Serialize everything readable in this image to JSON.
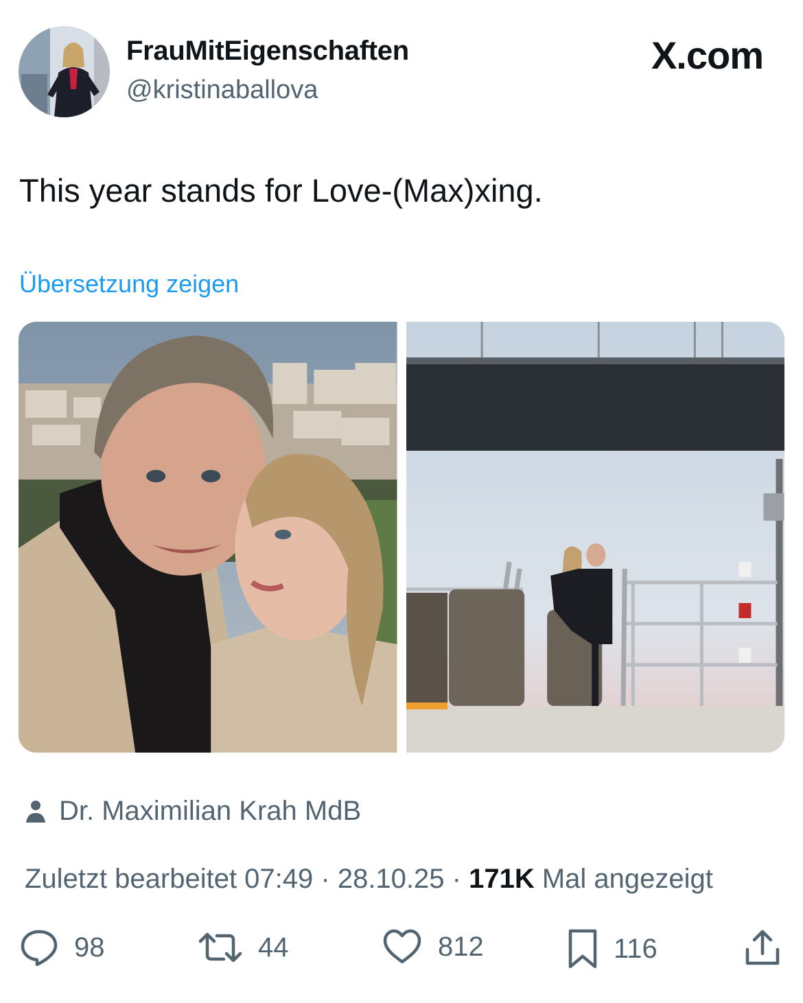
{
  "author": {
    "display_name": "FrauMitEigenschaften",
    "handle": "@kristinaballova",
    "avatar": "profile-avatar-photo"
  },
  "brand": {
    "logo_text": "X.com"
  },
  "tweet": {
    "text": "This year stands for Love-(Max)xing.",
    "translate_link": "Übersetzung zeigen",
    "media": [
      {
        "kind": "photo",
        "description_icon": "selfie-photo"
      },
      {
        "kind": "photo",
        "description_icon": "boat-under-bridge-photo"
      }
    ],
    "tagged_user": "Dr. Maximilian Krah MdB",
    "edited_label": "Zuletzt bearbeitet 07:49 · 28.10.25",
    "separator": "·",
    "views_count": "171K",
    "views_label": "Mal angezeigt"
  },
  "actions": {
    "replies": "98",
    "reposts": "44",
    "likes": "812",
    "bookmarks": "116"
  },
  "colors": {
    "link": "#1d9bf0",
    "secondary_text": "#536471",
    "primary_text": "#0f1419"
  }
}
